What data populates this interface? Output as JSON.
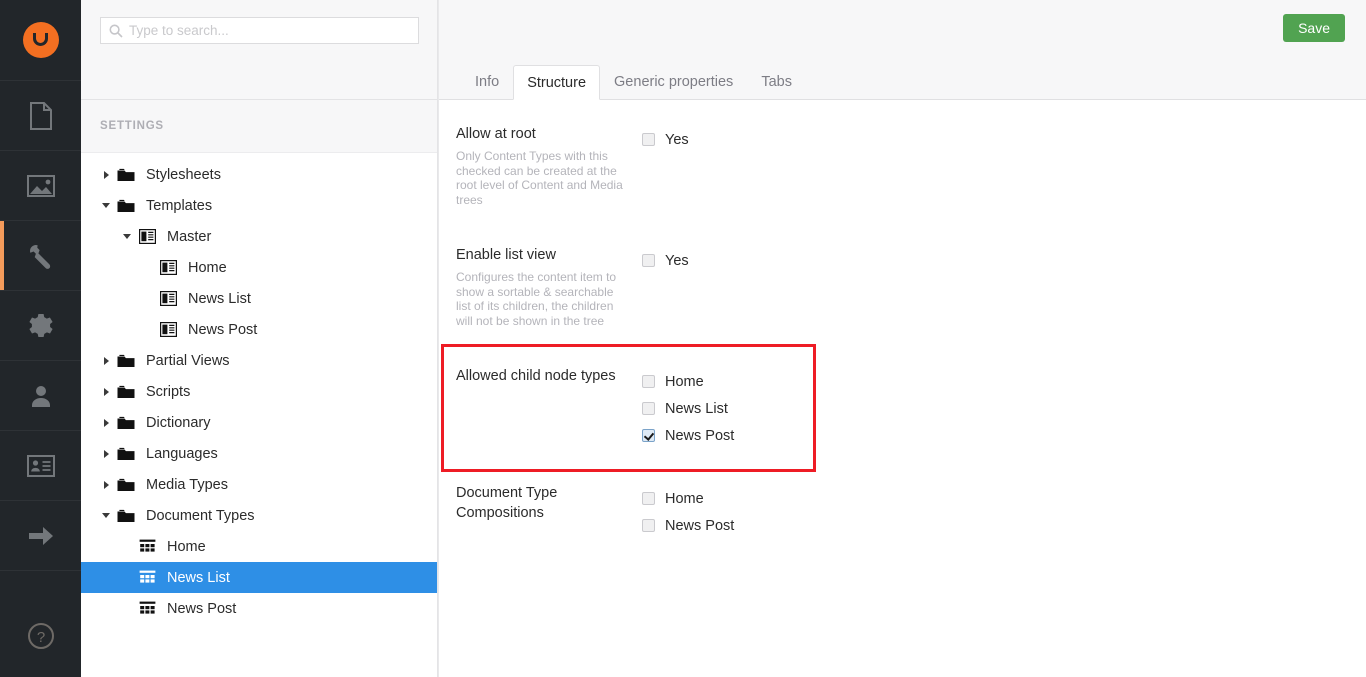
{
  "rail": {
    "logo_name": "umbraco-logo",
    "items": [
      {
        "name": "content-section",
        "icon": "document-icon",
        "active": false
      },
      {
        "name": "media-section",
        "icon": "image-icon",
        "active": false
      },
      {
        "name": "settings-section",
        "icon": "wrench-icon",
        "active": true
      },
      {
        "name": "developer-section",
        "icon": "gear-icon",
        "active": false
      },
      {
        "name": "users-section",
        "icon": "user-icon",
        "active": false
      },
      {
        "name": "members-section",
        "icon": "member-card-icon",
        "active": false
      },
      {
        "name": "forms-section",
        "icon": "arrow-right-icon",
        "active": false
      }
    ],
    "help_icon": "help-circle-icon",
    "accent_active": "#f49b5b",
    "brand_color": "#f36f21"
  },
  "search": {
    "placeholder": "Type to search...",
    "value": "",
    "icon": "search-icon"
  },
  "tree": {
    "section_title": "SETTINGS",
    "nodes": [
      {
        "label": "Stylesheets",
        "icon": "folder-icon",
        "depth": 0,
        "caret": "right",
        "selected": false
      },
      {
        "label": "Templates",
        "icon": "folder-icon",
        "depth": 0,
        "caret": "down",
        "selected": false
      },
      {
        "label": "Master",
        "icon": "template-icon",
        "depth": 1,
        "caret": "down",
        "selected": false
      },
      {
        "label": "Home",
        "icon": "template-icon",
        "depth": 2,
        "caret": "none",
        "selected": false
      },
      {
        "label": "News List",
        "icon": "template-icon",
        "depth": 2,
        "caret": "none",
        "selected": false
      },
      {
        "label": "News Post",
        "icon": "template-icon",
        "depth": 2,
        "caret": "none",
        "selected": false
      },
      {
        "label": "Partial Views",
        "icon": "folder-icon",
        "depth": 0,
        "caret": "right",
        "selected": false
      },
      {
        "label": "Scripts",
        "icon": "folder-icon",
        "depth": 0,
        "caret": "right",
        "selected": false
      },
      {
        "label": "Dictionary",
        "icon": "folder-icon",
        "depth": 0,
        "caret": "right",
        "selected": false
      },
      {
        "label": "Languages",
        "icon": "folder-icon",
        "depth": 0,
        "caret": "right",
        "selected": false
      },
      {
        "label": "Media Types",
        "icon": "folder-icon",
        "depth": 0,
        "caret": "right",
        "selected": false
      },
      {
        "label": "Document Types",
        "icon": "folder-icon",
        "depth": 0,
        "caret": "down",
        "selected": false
      },
      {
        "label": "Home",
        "icon": "document-type-icon",
        "depth": 1,
        "caret": "none",
        "selected": false
      },
      {
        "label": "News List",
        "icon": "document-type-icon",
        "depth": 1,
        "caret": "none",
        "selected": true
      },
      {
        "label": "News Post",
        "icon": "document-type-icon",
        "depth": 1,
        "caret": "none",
        "selected": false
      }
    ],
    "selected_color": "#2e8fe6"
  },
  "header": {
    "save_label": "Save",
    "save_color": "#51a351"
  },
  "tabs": [
    {
      "label": "Info",
      "active": false
    },
    {
      "label": "Structure",
      "active": true
    },
    {
      "label": "Generic properties",
      "active": false
    },
    {
      "label": "Tabs",
      "active": false
    }
  ],
  "properties": [
    {
      "title": "Allow at root",
      "description": "Only Content Types with this checked can be created at the root level of Content and Media trees",
      "options": [
        {
          "label": "Yes",
          "checked": false
        }
      ]
    },
    {
      "title": "Enable list view",
      "description": "Configures the content item to show a sortable & searchable list of its children, the children will not be shown in the tree",
      "options": [
        {
          "label": "Yes",
          "checked": false
        }
      ]
    },
    {
      "title": "Allowed child node types",
      "description": "",
      "options": [
        {
          "label": "Home",
          "checked": false
        },
        {
          "label": "News List",
          "checked": false
        },
        {
          "label": "News Post",
          "checked": true
        }
      ]
    },
    {
      "title": "Document Type Compositions",
      "description": "",
      "options": [
        {
          "label": "Home",
          "checked": false
        },
        {
          "label": "News Post",
          "checked": false
        }
      ]
    }
  ],
  "annotation": {
    "color": "#ee1c25",
    "target": "allowed-child-node-types"
  }
}
